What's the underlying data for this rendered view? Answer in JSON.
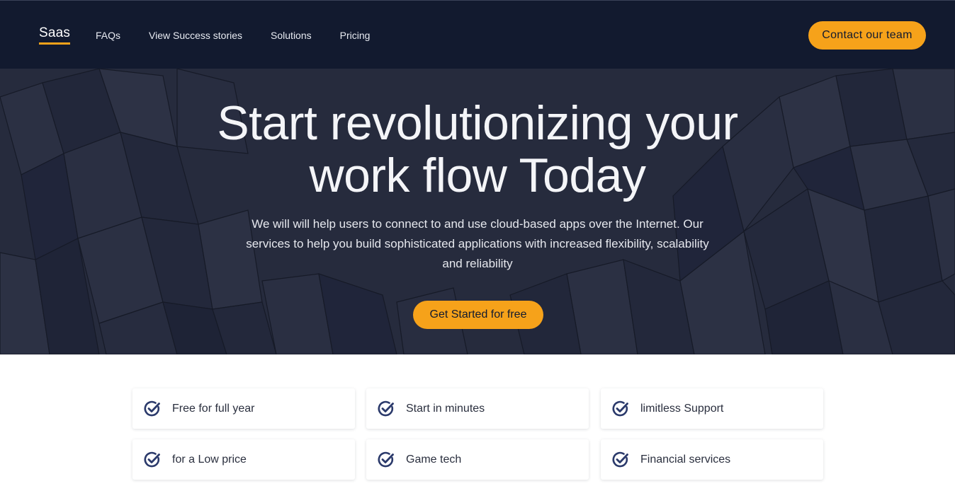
{
  "header": {
    "logo": "Saas",
    "nav": [
      "FAQs",
      "View Success stories",
      "Solutions",
      "Pricing"
    ],
    "contact_label": "Contact our team"
  },
  "hero": {
    "title_line1": "Start revolutionizing your",
    "title_line2": "work flow Today",
    "subtitle": "We will will help users to connect to and use cloud-based apps over the Internet. Our services to help you build sophisticated applications with increased flexibility, scalability and reliability",
    "cta_label": "Get Started for free"
  },
  "features": [
    "Free for full year",
    "Start in minutes",
    "limitless Support",
    "for a Low price",
    "Game tech",
    "Financial services"
  ],
  "colors": {
    "header_bg": "#121a2f",
    "hero_bg": "#262b3d",
    "accent": "#f6a21a",
    "check_icon": "#2b3a6b"
  },
  "icons": {
    "feature": "check-circle-icon"
  }
}
